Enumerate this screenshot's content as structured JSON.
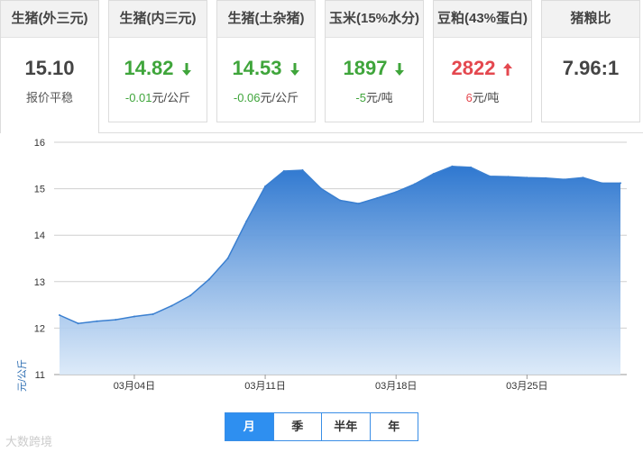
{
  "cards": [
    {
      "title": "生猪(外三元)",
      "value": "15.10",
      "change": "报价平稳",
      "trend": "flat"
    },
    {
      "title": "生猪(内三元)",
      "value": "14.82",
      "change": "-0.01",
      "unit": "元/公斤",
      "trend": "down"
    },
    {
      "title": "生猪(土杂猪)",
      "value": "14.53",
      "change": "-0.06",
      "unit": "元/公斤",
      "trend": "down"
    },
    {
      "title": "玉米(15%水分)",
      "value": "1897",
      "change": "-5",
      "unit": "元/吨",
      "trend": "down"
    },
    {
      "title": "豆粕(43%蛋白)",
      "value": "2822",
      "change": "6",
      "unit": "元/吨",
      "trend": "up"
    },
    {
      "title": "猪粮比",
      "value": "7.96:1",
      "change": "",
      "trend": "flat"
    }
  ],
  "colors": {
    "down": "#3fa53b",
    "up": "#e4484f",
    "line": "#3a7fd0",
    "accent": "#2e8ff0"
  },
  "chart_data": {
    "type": "area",
    "ylabel": "元/公斤",
    "ylim": [
      11,
      16
    ],
    "yticks": [
      11,
      12,
      13,
      14,
      15,
      16
    ],
    "xticks": [
      "03月04日",
      "03月11日",
      "03月18日",
      "03月25日"
    ],
    "grid": true,
    "x": [
      "02月29日",
      "03月01日",
      "03月02日",
      "03月03日",
      "03月04日",
      "03月05日",
      "03月06日",
      "03月07日",
      "03月08日",
      "03月09日",
      "03月10日",
      "03月11日",
      "03月12日",
      "03月13日",
      "03月14日",
      "03月15日",
      "03月16日",
      "03月17日",
      "03月18日",
      "03月19日",
      "03月20日",
      "03月21日",
      "03月22日",
      "03月23日",
      "03月24日",
      "03月25日",
      "03月26日",
      "03月27日",
      "03月28日",
      "03月29日",
      "03月30日"
    ],
    "series": [
      {
        "values": [
          12.28,
          12.1,
          12.15,
          12.18,
          12.25,
          12.3,
          12.48,
          12.7,
          13.05,
          13.5,
          14.3,
          15.05,
          15.38,
          15.4,
          15.0,
          14.75,
          14.68,
          14.8,
          14.93,
          15.1,
          15.32,
          15.48,
          15.46,
          15.27,
          15.26,
          15.24,
          15.23,
          15.2,
          15.24,
          15.12,
          15.12
        ]
      }
    ]
  },
  "tabs": [
    {
      "label": "月",
      "active": true
    },
    {
      "label": "季",
      "active": false
    },
    {
      "label": "半年",
      "active": false
    },
    {
      "label": "年",
      "active": false
    }
  ],
  "watermark": "大数跨境"
}
